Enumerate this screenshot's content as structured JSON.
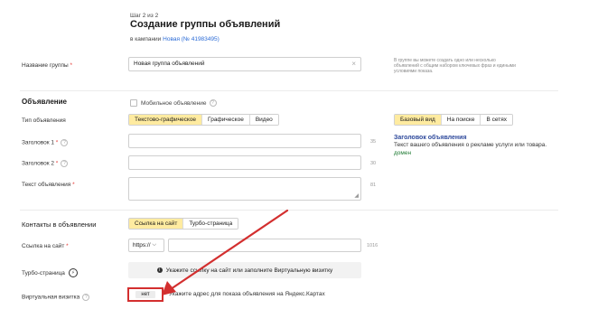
{
  "header": {
    "step": "Шаг 2 из 2",
    "title": "Создание группы объявлений",
    "campaign_prefix": "в кампании",
    "campaign_link": "Новая (№ 41983495)"
  },
  "group_name": {
    "label": "Название группы",
    "value": "Новая группа объявлений",
    "clear": "×",
    "side_hint": "В группе вы можете создать одно или несколько объявлений с общим набором ключевых фраз и едиными условиями показа."
  },
  "ad": {
    "section_title": "Объявление",
    "mobile_label": "Мобильное объявление",
    "type_label": "Тип объявления",
    "types": [
      "Текстово-графическое",
      "Графическое",
      "Видео"
    ],
    "headline1_label": "Заголовок 1",
    "headline1_count": "35",
    "headline2_label": "Заголовок 2",
    "headline2_count": "30",
    "text_label": "Текст объявления",
    "text_count": "81"
  },
  "preview": {
    "tabs": [
      "Базовый вид",
      "На поиске",
      "В сетях"
    ],
    "title": "Заголовок объявления",
    "text": "Текст вашего объявления о рекламе услуги или товара.",
    "domain": "домен"
  },
  "contacts": {
    "section_title": "Контакты в объявлении",
    "tabs": [
      "Ссылка на сайт",
      "Турбо-страница"
    ],
    "link_label": "Ссылка на сайт",
    "protocol": "https://",
    "link_count": "1016",
    "turbo_label": "Турбо-страница",
    "turbo_notice": "Укажите ссылку на сайт или заполните Виртуальную визитку",
    "vcard_label": "Виртуальная визитка",
    "vcard_button": "нет",
    "vcard_hint": "Укажите адрес для показа объявления на Яндекс.Картах"
  },
  "colors": {
    "accent_yellow": "#ffeba0",
    "link_blue": "#2b6bd6",
    "preview_title": "#2f4a9c",
    "preview_domain": "#1e7a32",
    "arrow_red": "#d32f2f"
  }
}
